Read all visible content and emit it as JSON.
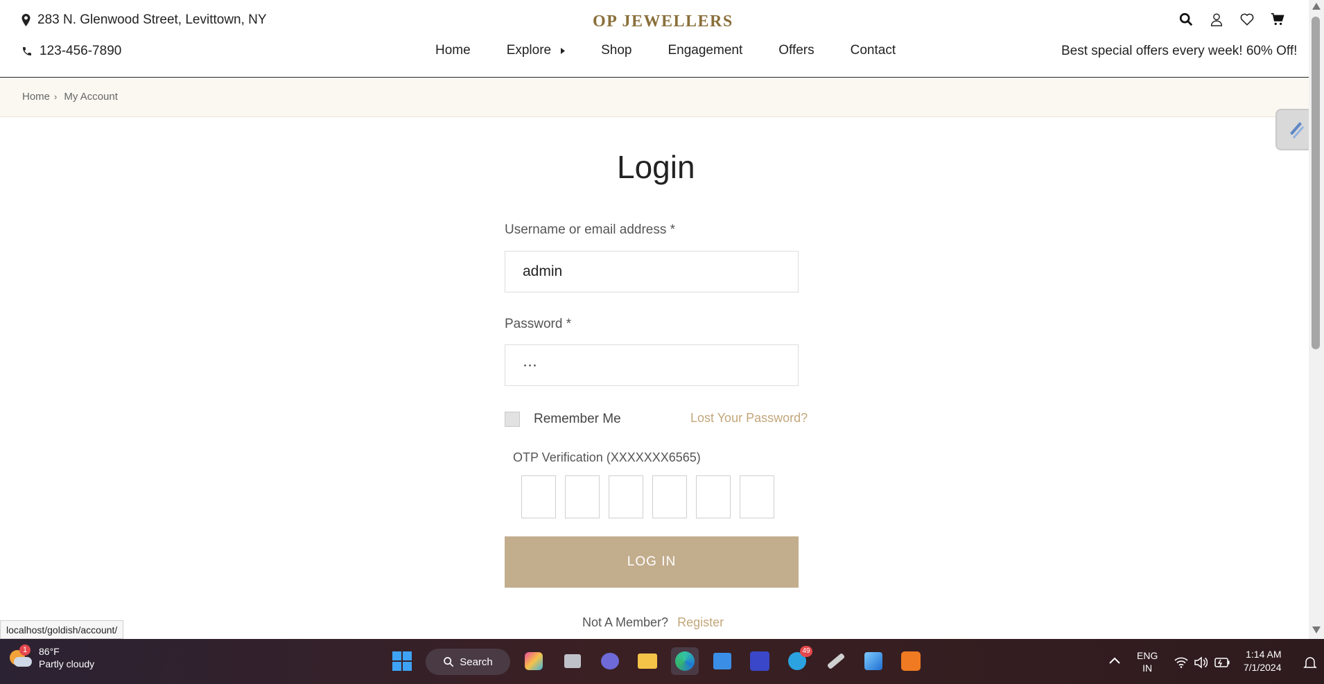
{
  "header": {
    "address": "283 N. Glenwood Street, Levittown, NY",
    "phone": "123-456-7890",
    "brand": "OP JEWELLERS",
    "offer": "Best special offers every week! 60% Off!",
    "nav": [
      "Home",
      "Explore",
      "Shop",
      "Engagement",
      "Offers",
      "Contact"
    ]
  },
  "breadcrumb": {
    "home": "Home",
    "current": "My Account"
  },
  "login": {
    "title": "Login",
    "username_label": "Username or email address",
    "required_mark": "*",
    "username_value": "admin",
    "password_label": "Password",
    "password_value": "···",
    "remember_label": "Remember Me",
    "lost_password": "Lost Your Password?",
    "otp_label": "OTP Verification (XXXXXXX6565)",
    "button": "LOG IN",
    "not_member": "Not A Member?",
    "register": "Register"
  },
  "status_url": "localhost/goldish/account/",
  "taskbar": {
    "weather_temp": "86°F",
    "weather_desc": "Partly cloudy",
    "weather_badge": "1",
    "search_label": "Search",
    "telegram_badge": "49",
    "lang_top": "ENG",
    "lang_bottom": "IN",
    "time": "1:14 AM",
    "date": "7/1/2024"
  },
  "colors": {
    "accent": "#c2ad8d",
    "link": "#c2a67a",
    "brand": "#8a6f3a",
    "breadcrumb_bg": "#fbf8f2"
  }
}
